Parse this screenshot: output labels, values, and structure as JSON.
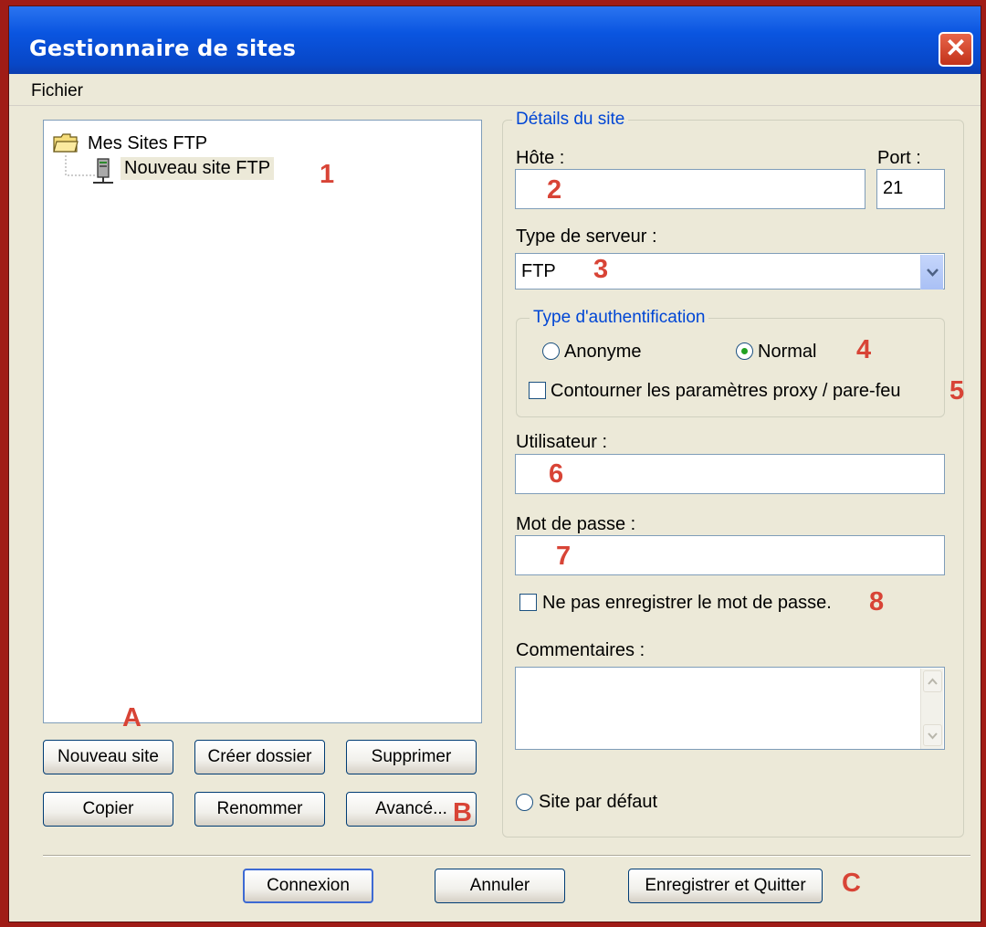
{
  "window": {
    "title": "Gestionnaire de sites"
  },
  "menu": {
    "file": "Fichier"
  },
  "tree": {
    "root": "Mes Sites FTP",
    "child": "Nouveau site FTP"
  },
  "details": {
    "legend": "Détails du site",
    "host_label": "Hôte :",
    "host_value": "",
    "port_label": "Port :",
    "port_value": "21",
    "server_type_label": "Type de serveur :",
    "server_type_value": "FTP",
    "auth_legend": "Type d'authentification",
    "auth_anonymous": "Anonyme",
    "auth_normal": "Normal",
    "auth_selected": "Normal",
    "bypass_proxy": "Contourner les paramètres proxy / pare-feu",
    "user_label": "Utilisateur :",
    "password_label": "Mot de passe :",
    "dont_save_password": "Ne pas enregistrer le mot de passe.",
    "comments_label": "Commentaires :",
    "default_site": "Site par défaut"
  },
  "buttons": {
    "new_site": "Nouveau site",
    "create_folder": "Créer dossier",
    "delete": "Supprimer",
    "copy": "Copier",
    "rename": "Renommer",
    "advanced": "Avancé...",
    "connect": "Connexion",
    "cancel": "Annuler",
    "save_quit": "Enregistrer et Quitter"
  },
  "annotations": {
    "n1": "1",
    "n2": "2",
    "n3": "3",
    "n4": "4",
    "n5": "5",
    "n6": "6",
    "n7": "7",
    "n8": "8",
    "a": "A",
    "b": "B",
    "c": "C"
  },
  "colors": {
    "title_bar": "#0a55e0",
    "annotation": "#d84436",
    "dialog_bg": "#ece9d8",
    "border_red": "#a01c16"
  }
}
